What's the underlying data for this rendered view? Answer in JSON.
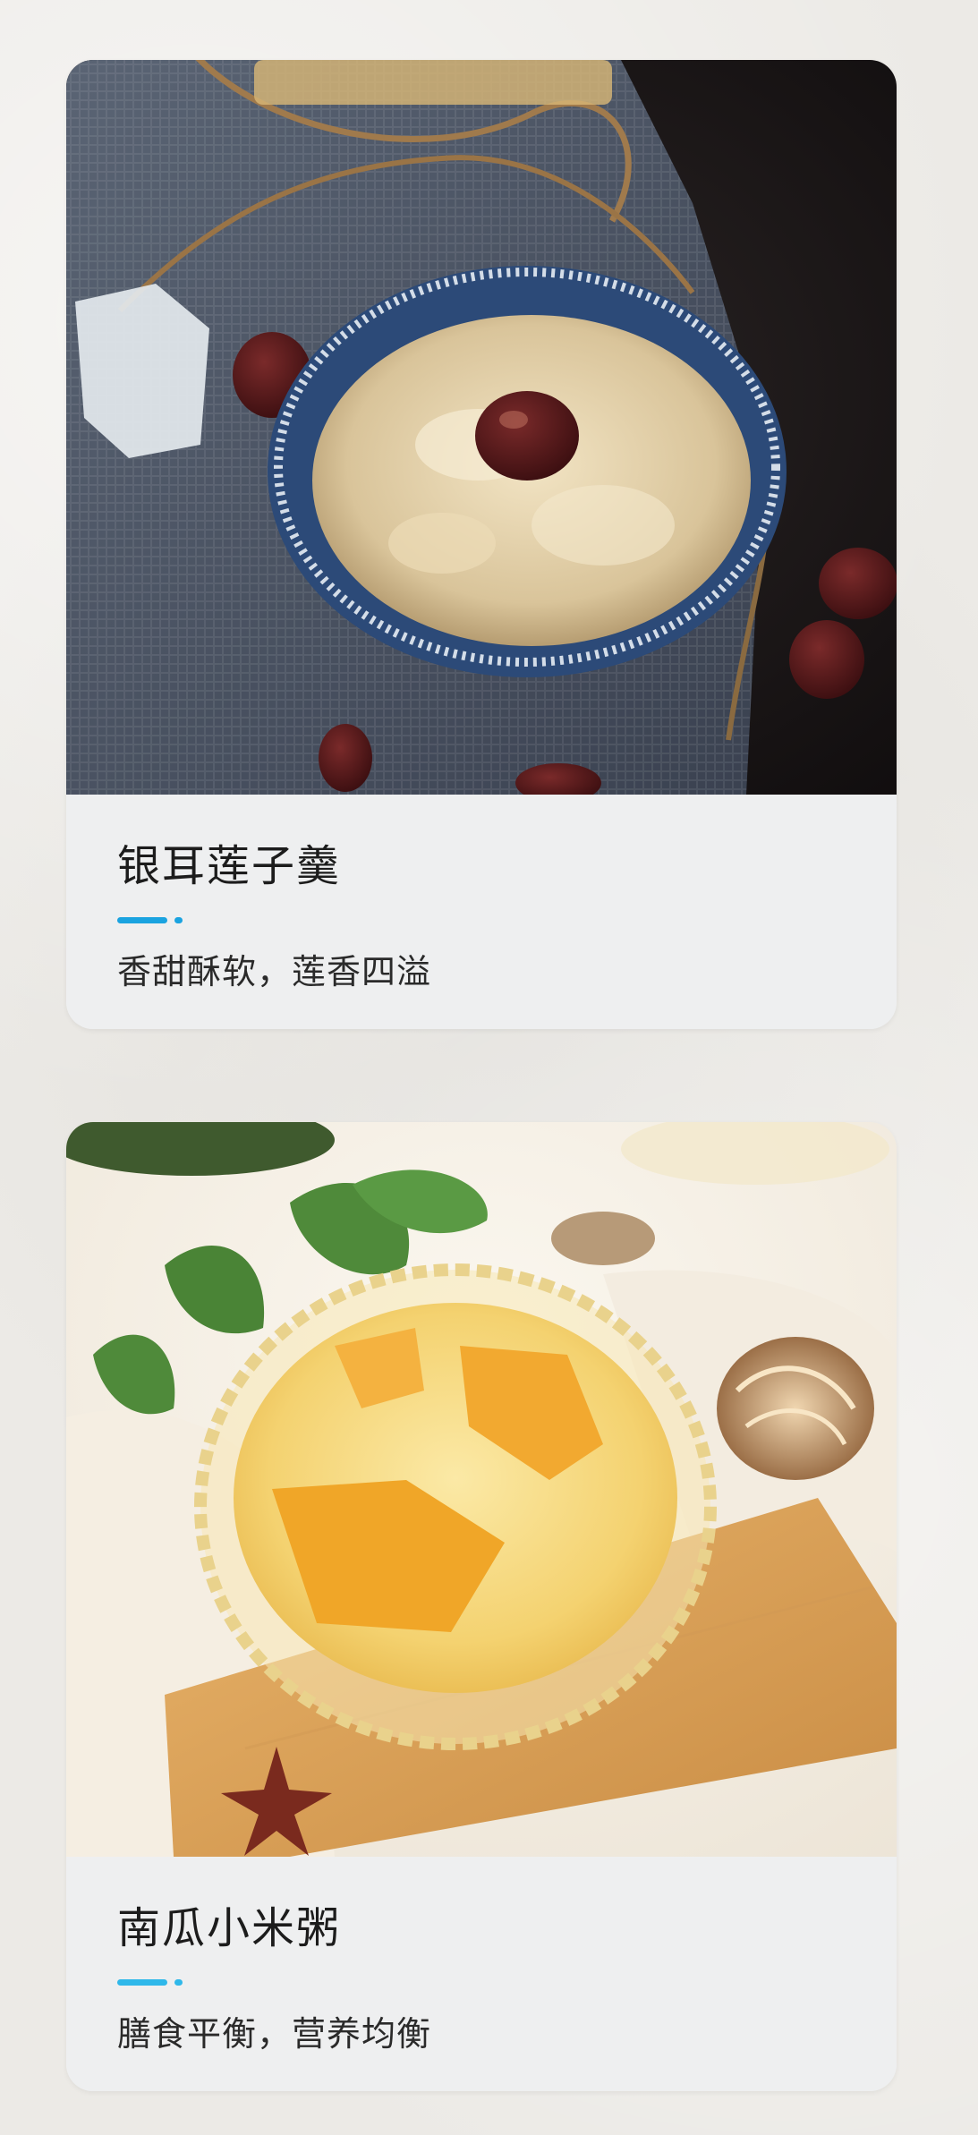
{
  "colors": {
    "accent": "#1aa3e0",
    "accent_light": "#2fb8ea",
    "card_background": "#eeeff0",
    "page_background": "#eceae6"
  },
  "cards": [
    {
      "title": "银耳莲子羹",
      "subtitle": "香甜酥软，莲香四溢",
      "image_icon": "tremella-lotus-soup-photo"
    },
    {
      "title": "南瓜小米粥",
      "subtitle": "膳食平衡，营养均衡",
      "image_icon": "pumpkin-millet-porridge-photo"
    }
  ]
}
